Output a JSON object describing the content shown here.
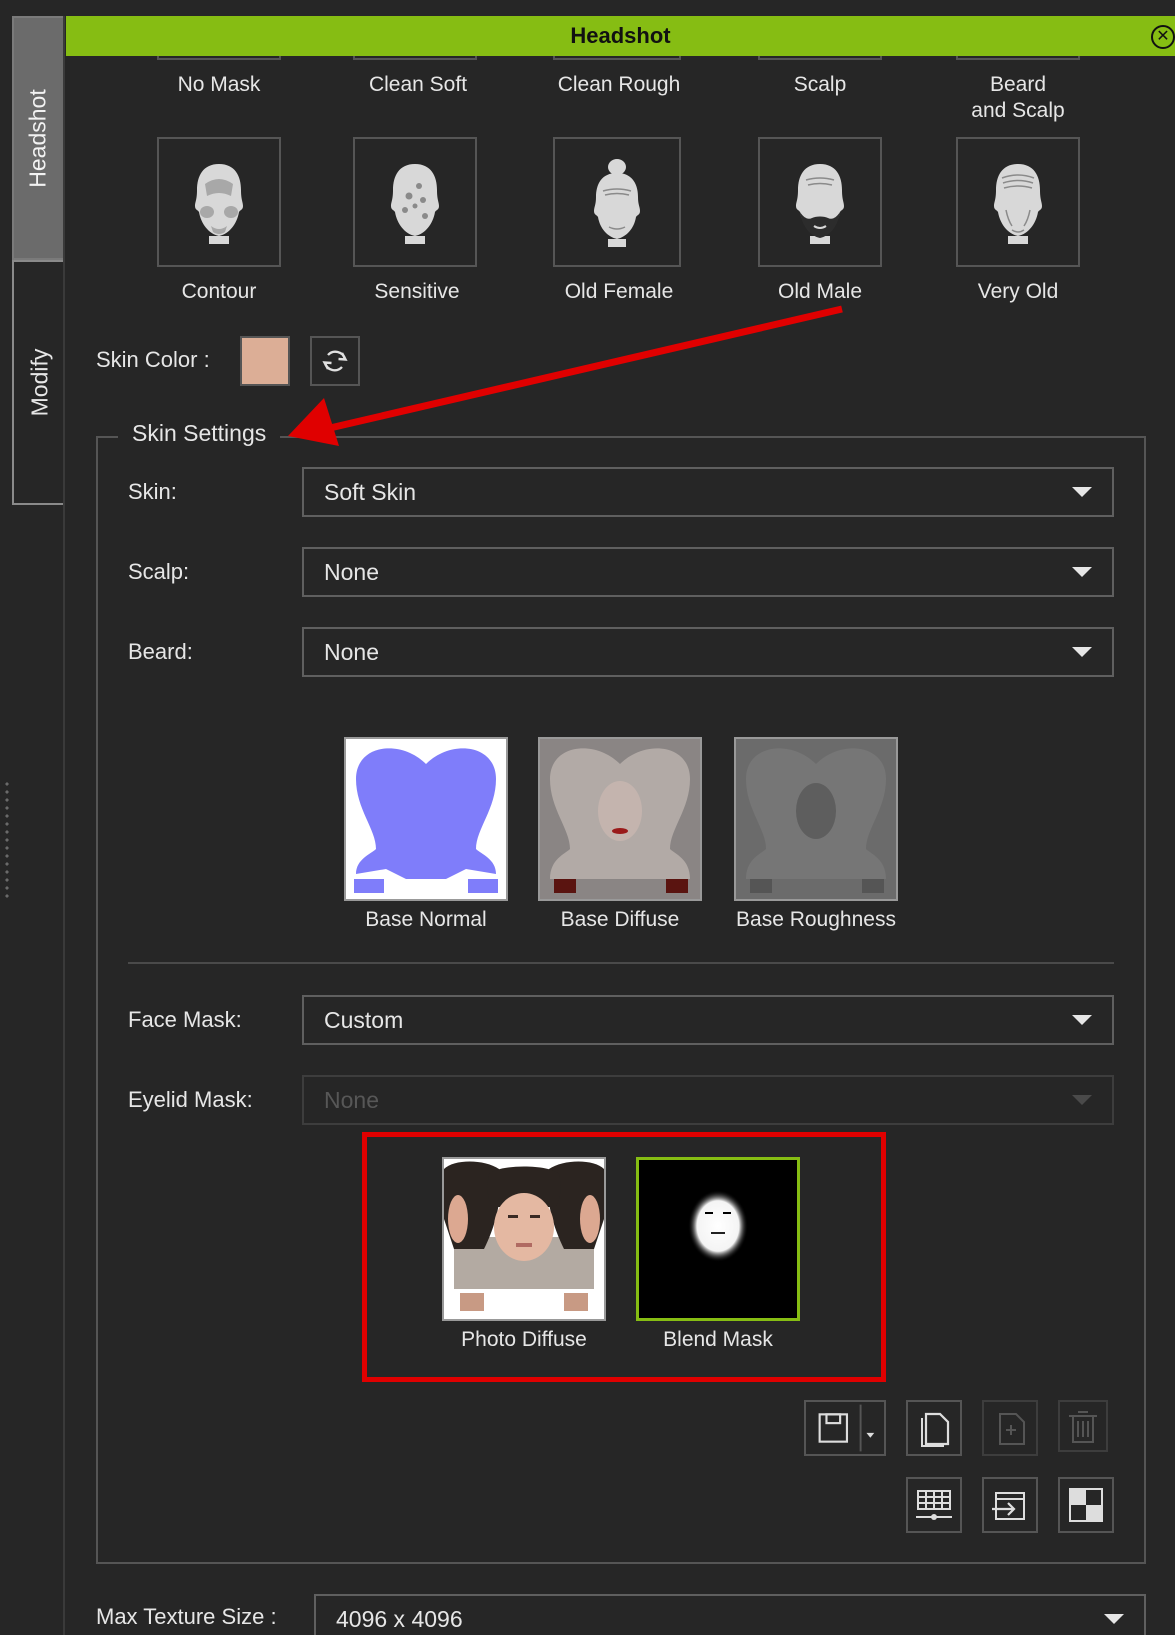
{
  "panel": {
    "title": "Headshot"
  },
  "side_tabs": [
    {
      "label": "Headshot",
      "active": true
    },
    {
      "label": "Modify",
      "active": false
    }
  ],
  "presets_row1": [
    "No Mask",
    "Clean Soft",
    "Clean Rough",
    "Scalp",
    "Beard\nand Scalp"
  ],
  "presets_row2": [
    {
      "label": "Contour",
      "icon": "head-contour-icon"
    },
    {
      "label": "Sensitive",
      "icon": "head-sensitive-icon"
    },
    {
      "label": "Old Female",
      "icon": "head-old-female-icon"
    },
    {
      "label": "Old Male",
      "icon": "head-old-male-icon"
    },
    {
      "label": "Very Old",
      "icon": "head-very-old-icon"
    }
  ],
  "skin_color": {
    "label": "Skin Color :",
    "color": "#dcae96"
  },
  "skin_settings": {
    "title": "Skin Settings",
    "skin": {
      "label": "Skin:",
      "value": "Soft Skin"
    },
    "scalp": {
      "label": "Scalp:",
      "value": "None"
    },
    "beard": {
      "label": "Beard:",
      "value": "None"
    },
    "textures": [
      "Base Normal",
      "Base Diffuse",
      "Base Roughness"
    ],
    "face_mask": {
      "label": "Face Mask:",
      "value": "Custom"
    },
    "eyelid_mask": {
      "label": "Eyelid Mask:",
      "value": "None",
      "disabled": true
    },
    "mask_textures": [
      "Photo Diffuse",
      "Blend Mask"
    ]
  },
  "max_texture": {
    "label": "Max Texture Size :",
    "value": "4096 x 4096"
  },
  "colors": {
    "accent": "#86bd13",
    "annotation": "#e00000",
    "selected_border": "#86bd13"
  }
}
